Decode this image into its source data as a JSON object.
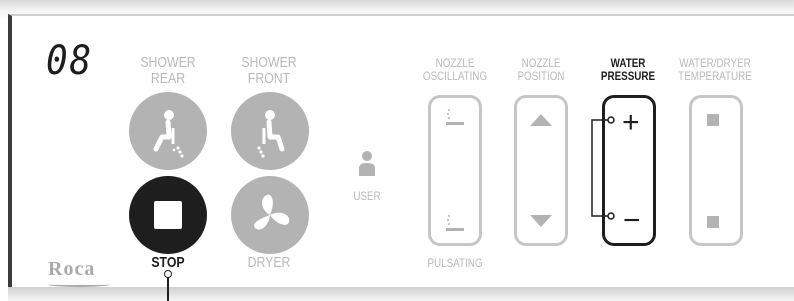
{
  "display": {
    "value": "08"
  },
  "brand": {
    "logo": "Roca"
  },
  "buttons": {
    "shower_rear": {
      "label_1": "SHOWER",
      "label_2": "REAR",
      "icon": "shower-rear-icon"
    },
    "shower_front": {
      "label_1": "SHOWER",
      "label_2": "FRONT",
      "icon": "shower-front-icon"
    },
    "stop": {
      "label": "STOP",
      "icon": "stop-icon"
    },
    "dryer": {
      "label": "DRYER",
      "icon": "fan-icon"
    }
  },
  "user": {
    "label": "USER"
  },
  "controls": {
    "nozzle_oscillating": {
      "label_1": "NOZZLE",
      "label_2": "OSCILLATING",
      "bottom_label": "PULSATING"
    },
    "nozzle_position": {
      "label_1": "NOZZLE",
      "label_2": "POSITION"
    },
    "water_pressure": {
      "label_1": "WATER",
      "label_2": "PRESSURE",
      "plus": "+",
      "minus": "−"
    },
    "water_dryer_temperature": {
      "label_1": "WATER/DRYER",
      "label_2": "TEMPERATURE"
    }
  },
  "colors": {
    "active": "#1e1e1e",
    "inactive": "#b3b3b3",
    "outline": "#c6c6c6"
  }
}
